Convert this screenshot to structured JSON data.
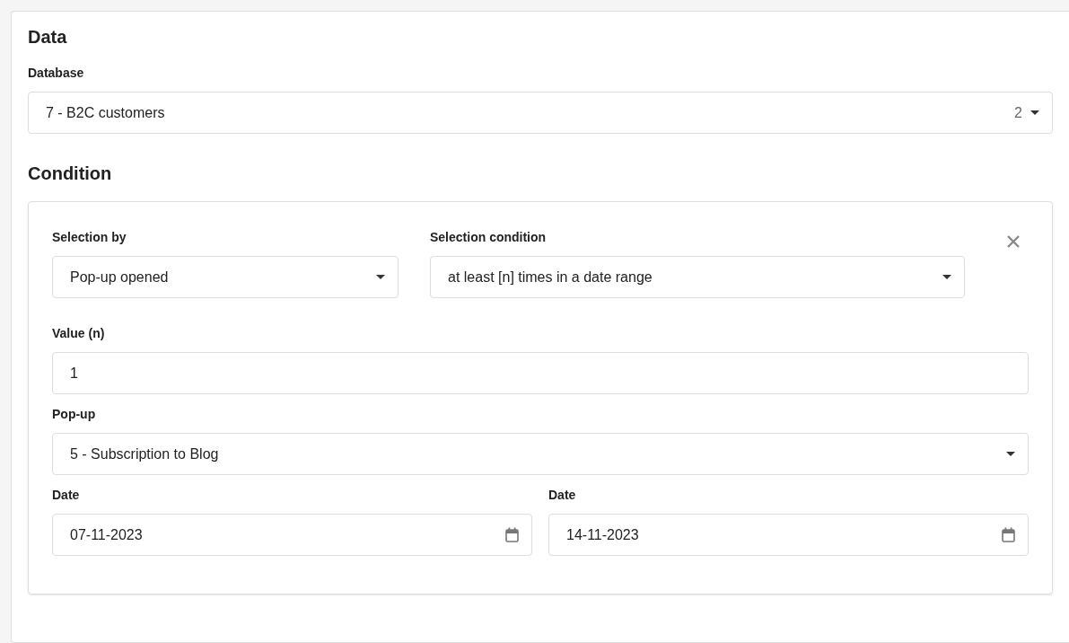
{
  "data": {
    "title": "Data",
    "database": {
      "label": "Database",
      "value": "7 - B2C customers",
      "count": "2"
    }
  },
  "condition": {
    "title": "Condition",
    "rules": [
      {
        "selection_by": {
          "label": "Selection by",
          "value": "Pop-up opened"
        },
        "selection_condition": {
          "label": "Selection condition",
          "value": "at least [n] times in a date range"
        },
        "value_n": {
          "label": "Value (n)",
          "value": "1"
        },
        "popup": {
          "label": "Pop-up",
          "value": "5 - Subscription to Blog"
        },
        "dates": [
          {
            "label": "Date",
            "value": "07-11-2023"
          },
          {
            "label": "Date",
            "value": "14-11-2023"
          }
        ]
      }
    ]
  }
}
